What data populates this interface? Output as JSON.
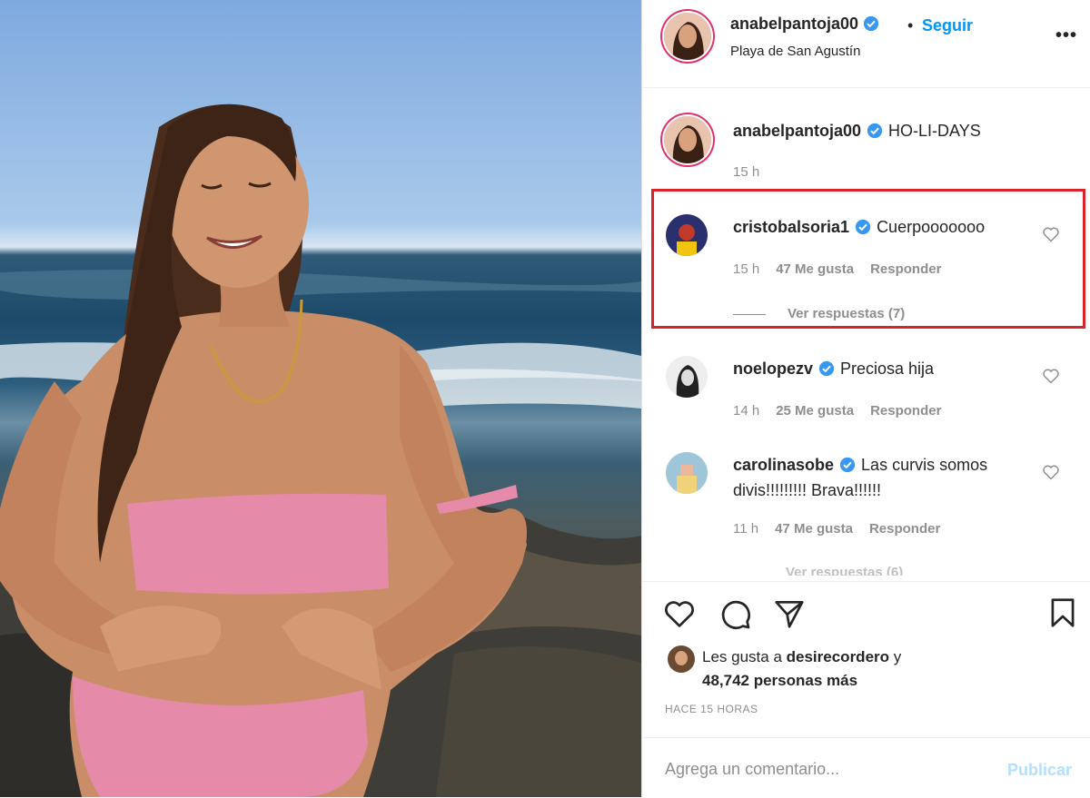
{
  "post": {
    "author": "anabelpantoja00",
    "follow_label": "Seguir",
    "separator": "•",
    "location": "Playa de San Agustín",
    "more_label": "•••"
  },
  "caption": {
    "author": "anabelpantoja00",
    "text": "HO-LI-DAYS",
    "time": "15 h"
  },
  "comments": [
    {
      "author": "cristobalsoria1",
      "text": "Cuerpooooooo",
      "time": "15 h",
      "likes": "47 Me gusta",
      "reply": "Responder",
      "view_replies": "Ver respuestas (7)"
    },
    {
      "author": "noelopezv",
      "text": "Preciosa hija",
      "time": "14 h",
      "likes": "25 Me gusta",
      "reply": "Responder"
    },
    {
      "author": "carolinasobe",
      "text": "Las curvis somos divis!!!!!!!!! Brava!!!!!!",
      "time": "11 h",
      "likes": "47 Me gusta",
      "reply": "Responder"
    }
  ],
  "partial_text": "Ver respuestas (6)",
  "likes": {
    "prefix": "Les gusta a",
    "user": "desirecordero",
    "joiner": "y",
    "count": "48,742 personas más"
  },
  "posted": "HACE 15 HORAS",
  "composer": {
    "placeholder": "Agrega un comentario...",
    "publish_label": "Publicar"
  },
  "colors": {
    "accent": "#0095f6",
    "verified": "#3897f0",
    "highlight_border": "#d8232a",
    "bikini": "#e58aa8",
    "publish_disabled": "#b2dffc"
  },
  "icons": [
    "verified-badge-icon",
    "more-options-icon",
    "heart-icon",
    "comment-icon",
    "share-icon",
    "bookmark-icon"
  ]
}
